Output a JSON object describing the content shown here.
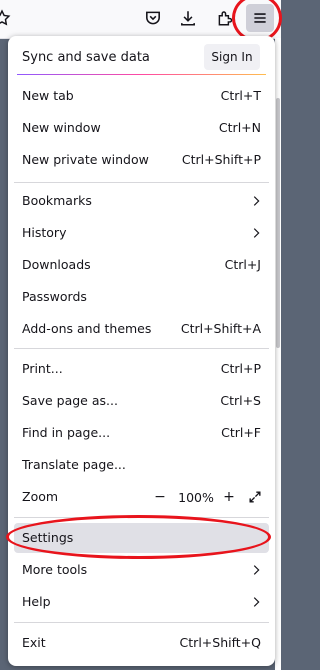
{
  "toolbar": {
    "icons": [
      "star-icon",
      "pocket-icon",
      "download-icon",
      "extensions-icon",
      "hamburger-menu-icon"
    ]
  },
  "menu": {
    "sync": {
      "label": "Sync and save data",
      "sign_in": "Sign In"
    },
    "items": {
      "new_tab": {
        "label": "New tab",
        "shortcut": "Ctrl+T"
      },
      "new_window": {
        "label": "New window",
        "shortcut": "Ctrl+N"
      },
      "new_private_window": {
        "label": "New private window",
        "shortcut": "Ctrl+Shift+P"
      },
      "bookmarks": {
        "label": "Bookmarks"
      },
      "history": {
        "label": "History"
      },
      "downloads": {
        "label": "Downloads",
        "shortcut": "Ctrl+J"
      },
      "passwords": {
        "label": "Passwords"
      },
      "addons": {
        "label": "Add-ons and themes",
        "shortcut": "Ctrl+Shift+A"
      },
      "print": {
        "label": "Print...",
        "shortcut": "Ctrl+P"
      },
      "save_page": {
        "label": "Save page as...",
        "shortcut": "Ctrl+S"
      },
      "find": {
        "label": "Find in page...",
        "shortcut": "Ctrl+F"
      },
      "translate": {
        "label": "Translate page..."
      },
      "zoom": {
        "label": "Zoom",
        "minus": "−",
        "level": "100%",
        "plus": "+"
      },
      "settings": {
        "label": "Settings"
      },
      "more_tools": {
        "label": "More tools"
      },
      "help": {
        "label": "Help"
      },
      "exit": {
        "label": "Exit",
        "shortcut": "Ctrl+Shift+Q"
      }
    }
  },
  "colors": {
    "annotation": "#e8141c",
    "highlight": "#e0e0e6"
  }
}
